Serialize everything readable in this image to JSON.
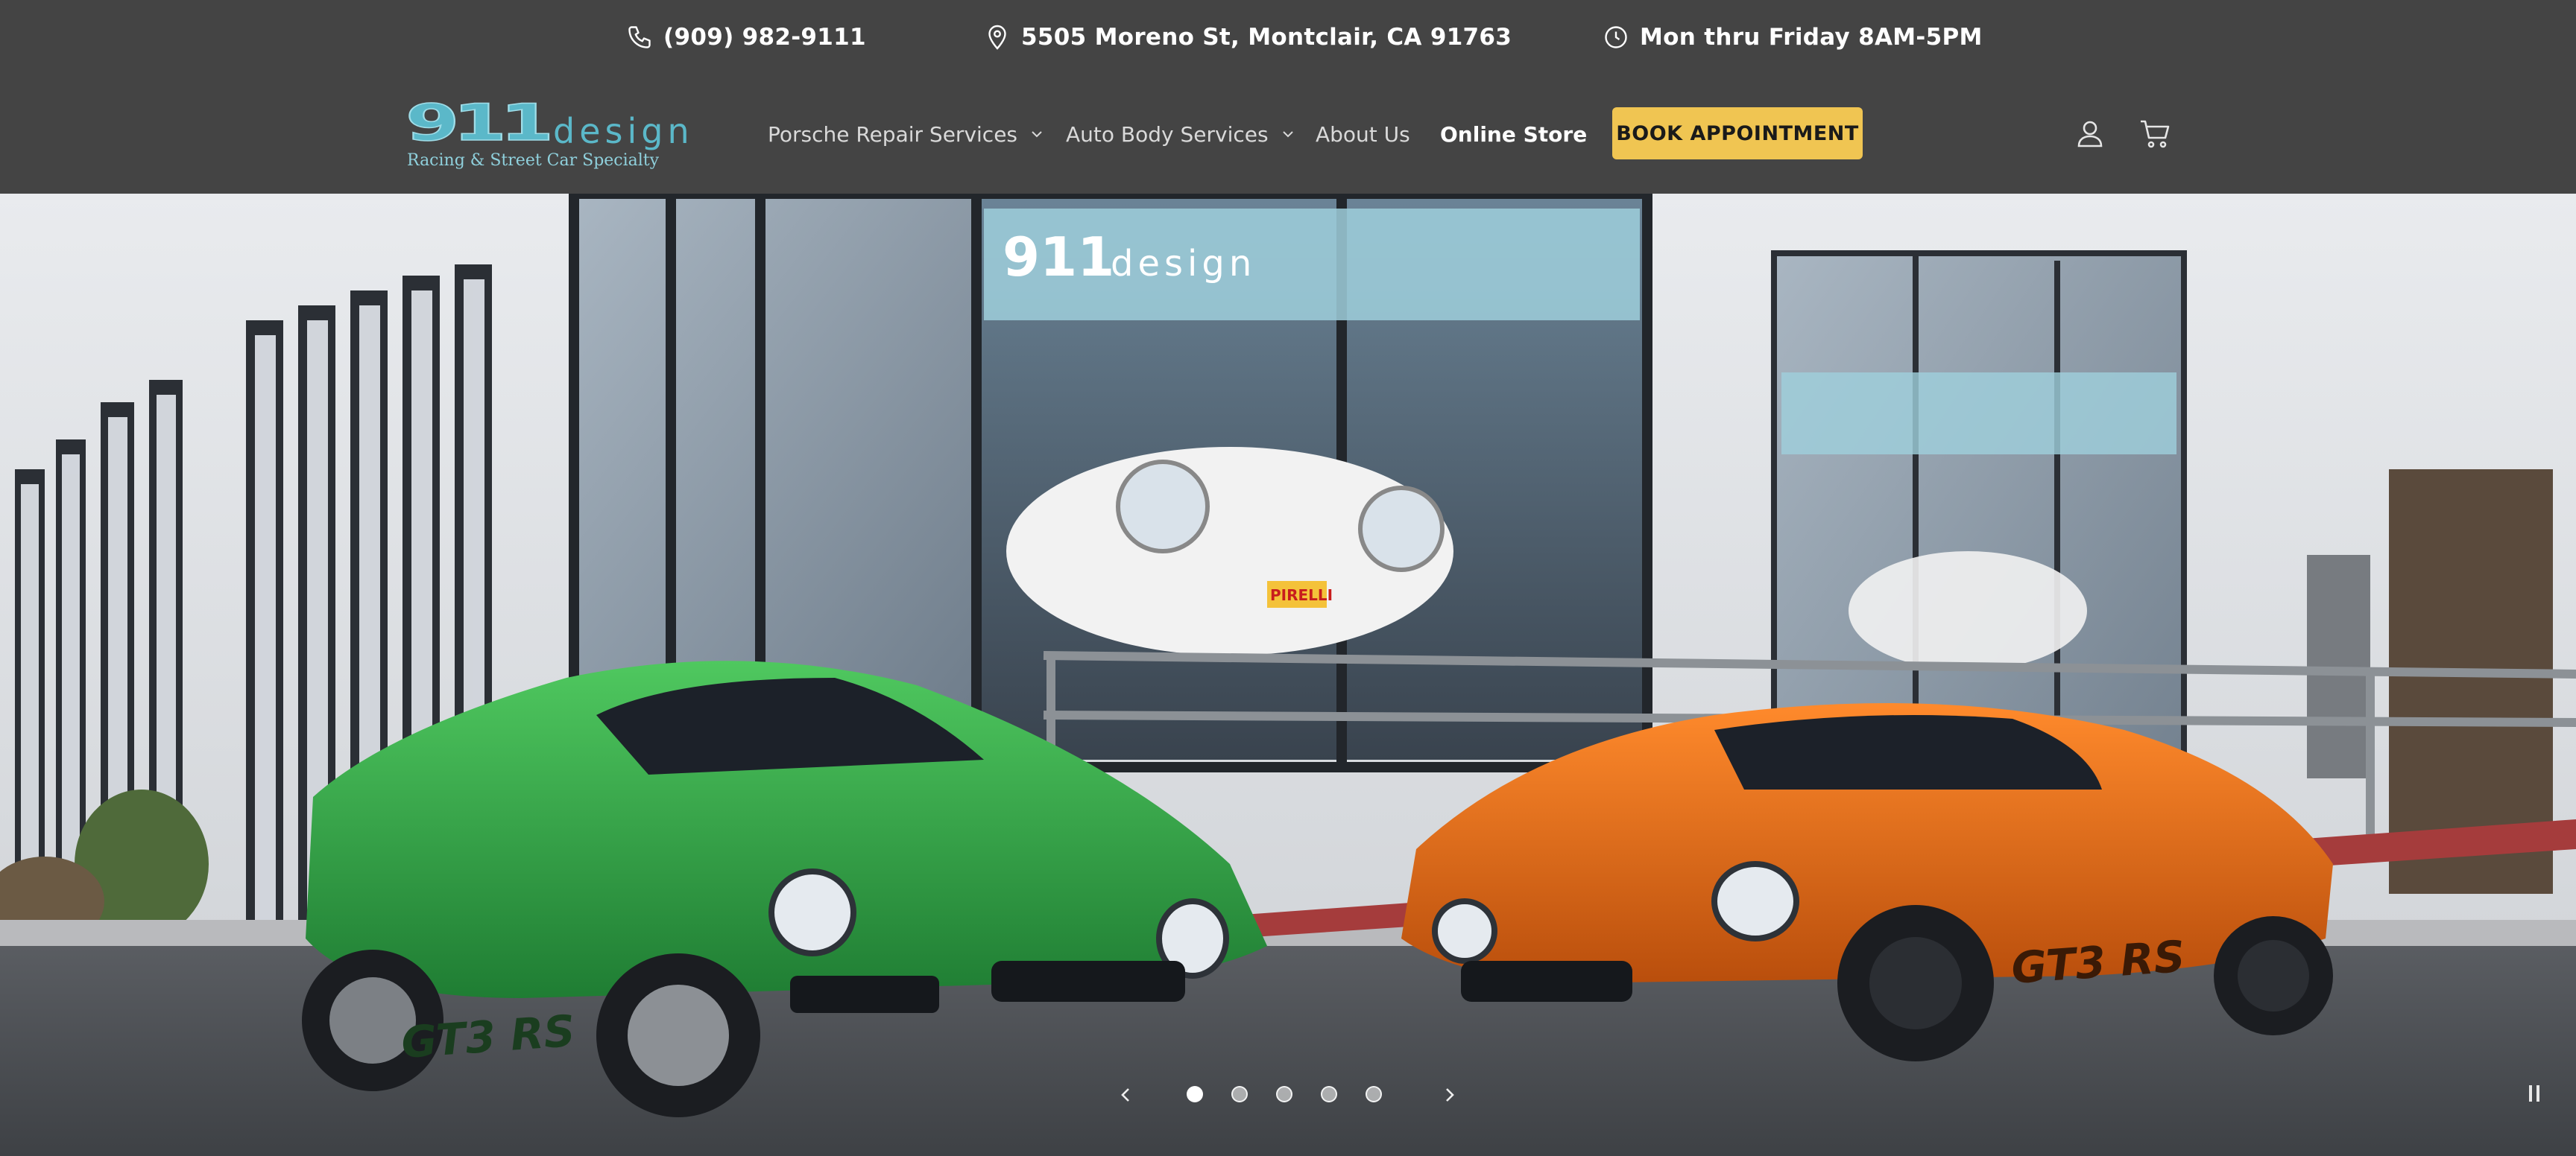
{
  "topbar": {
    "phone": "(909) 982-9111",
    "address": "5505 Moreno St, Montclair, CA 91763",
    "hours": "Mon thru Friday 8AM-5PM",
    "icons": [
      "phone-icon",
      "location-pin-icon",
      "clock-icon"
    ]
  },
  "header": {
    "logo": {
      "mark": "911",
      "word": "design",
      "tagline": "Racing & Street Car Specialty"
    },
    "nav": [
      {
        "label": "Porsche Repair Services",
        "has_dropdown": true
      },
      {
        "label": "Auto Body Services",
        "has_dropdown": true
      },
      {
        "label": "About Us",
        "has_dropdown": false
      },
      {
        "label": "Online Store",
        "has_dropdown": false
      }
    ],
    "cta_label": "BOOK APPOINTMENT",
    "icons": [
      "account-icon",
      "cart-icon"
    ]
  },
  "hero": {
    "slide_count": 5,
    "active_slide": 1,
    "car_left_badge": "GT3 RS",
    "car_right_badge": "GT3 RS",
    "building_sign_mark": "911",
    "building_sign_word": "design",
    "banner_brand": "PIRELLI"
  },
  "colors": {
    "bar_bg": "#444444",
    "cta_bg": "#f0c552",
    "logo_teal": "#5bb8c9",
    "car_left": "#34a64a",
    "car_right": "#e36b1a"
  }
}
